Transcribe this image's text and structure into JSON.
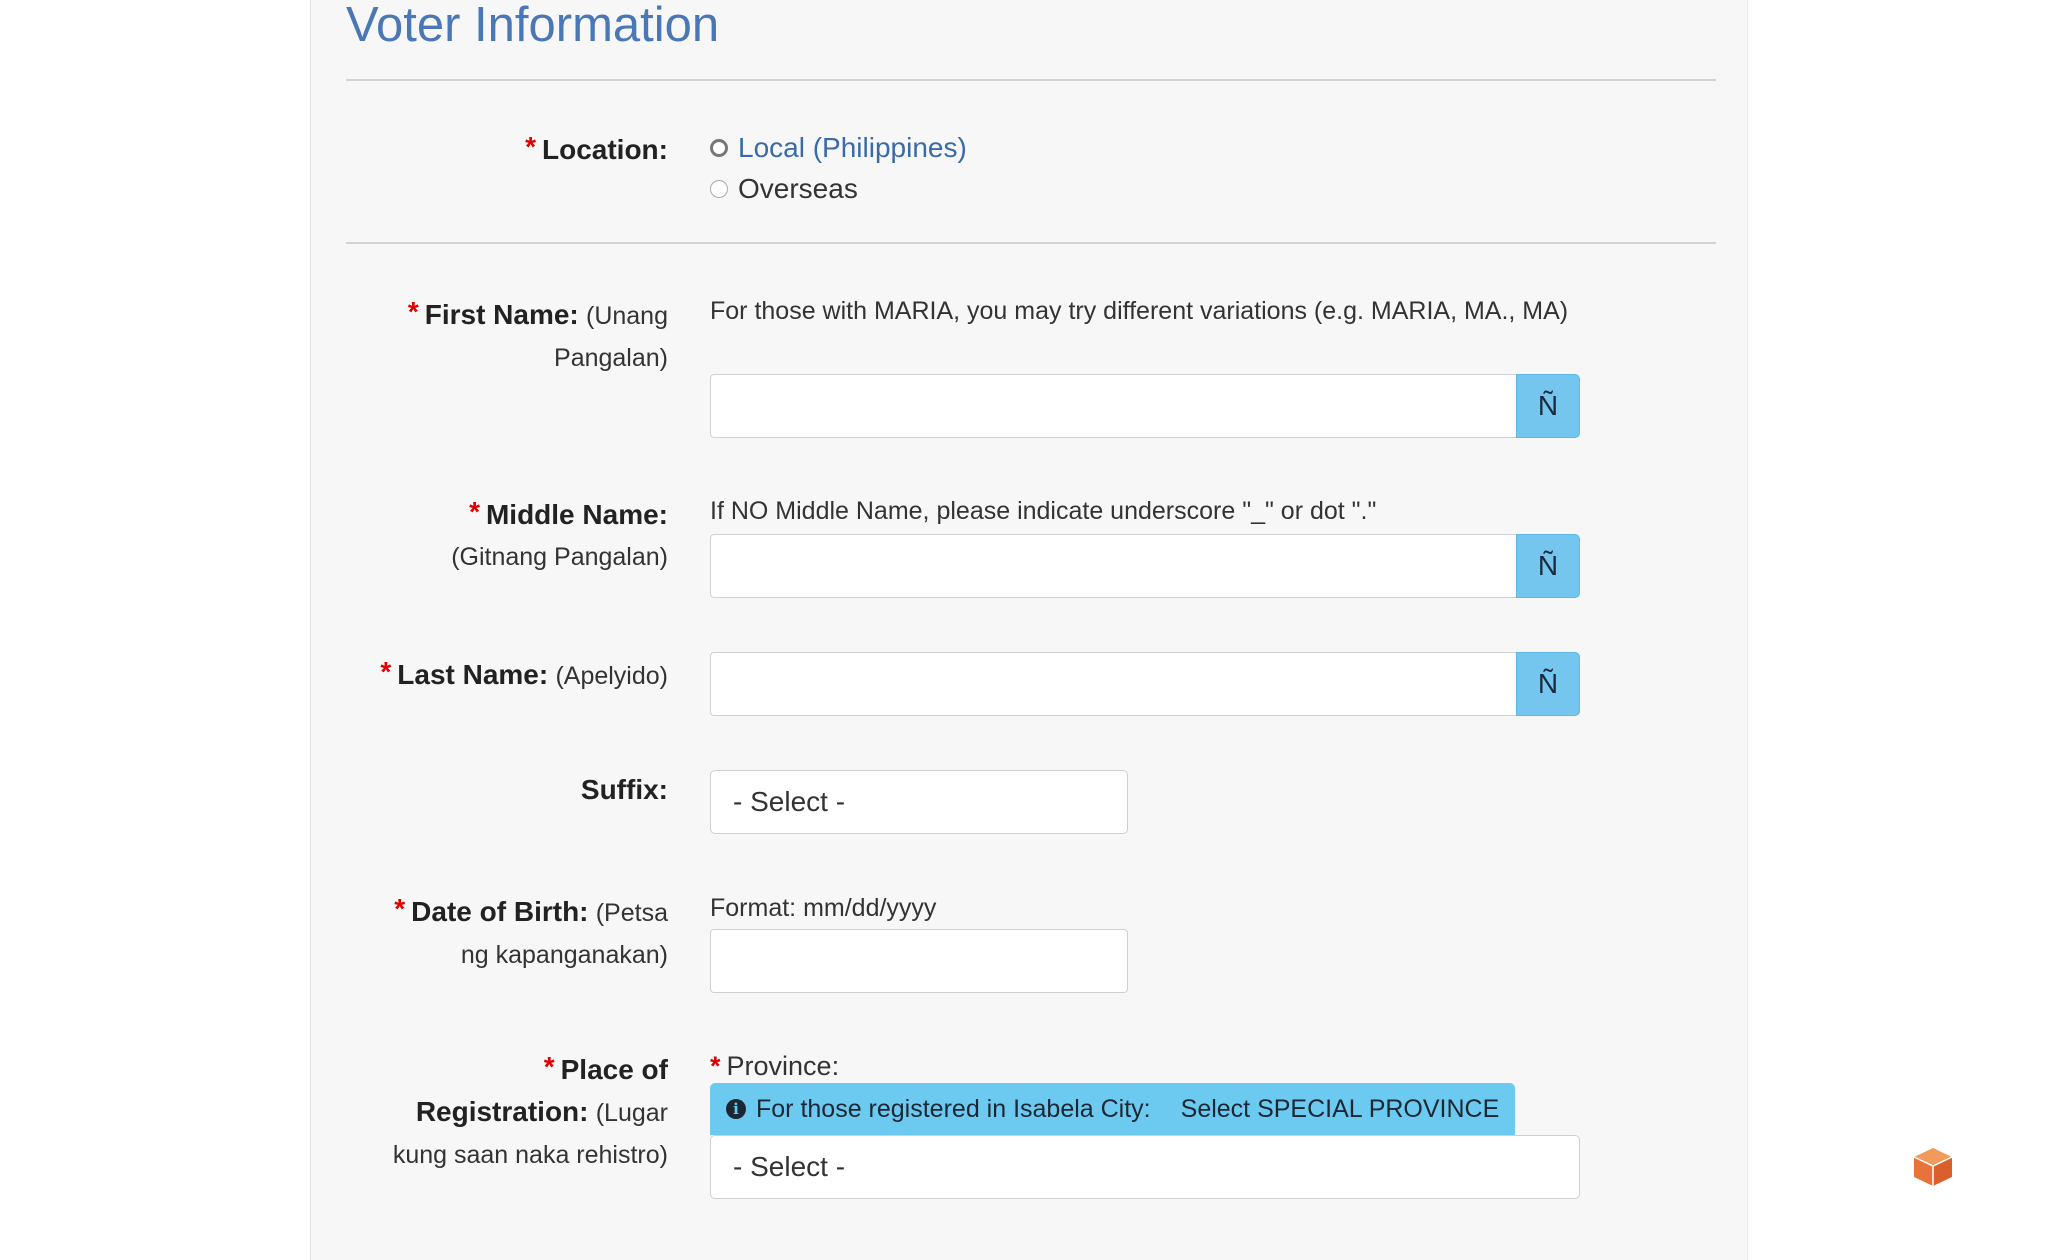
{
  "section": {
    "title": "Voter Information"
  },
  "location": {
    "label": "Location:",
    "options": [
      {
        "label": "Local (Philippines)",
        "selected": true
      },
      {
        "label": "Overseas",
        "selected": false
      }
    ]
  },
  "first_name": {
    "label": "First Name:",
    "sublabel": "(Unang Pangalan)",
    "help": "For those with MARIA, you may try different variations (e.g. MARIA, MA., MA)",
    "value": "",
    "enye_button": "Ñ"
  },
  "middle_name": {
    "label": "Middle Name:",
    "sublabel": "(Gitnang Pangalan)",
    "help": "If NO Middle Name, please indicate underscore \"_\" or dot \".\"",
    "value": "",
    "enye_button": "Ñ"
  },
  "last_name": {
    "label": "Last Name:",
    "sublabel": "(Apelyido)",
    "value": "",
    "enye_button": "Ñ"
  },
  "suffix": {
    "label": "Suffix:",
    "selected": "- Select -"
  },
  "date_of_birth": {
    "label": "Date of Birth:",
    "sublabel": "(Petsa ng kapanganakan)",
    "help": "Format: mm/dd/yyyy",
    "value": ""
  },
  "place_of_registration": {
    "label": "Place of Registration:",
    "sublabel": "(Lugar kung saan naka rehistro)",
    "province_label": "Province:",
    "info_prefix": "For those registered in Isabela City:",
    "info_suffix": "Select SPECIAL PROVINCE",
    "selected": "- Select -"
  },
  "required_marker": "*",
  "icons": {
    "info": "info-circle-icon",
    "widget": "cube-icon"
  },
  "colors": {
    "title_blue": "#4a78b6",
    "required_red": "#e00000",
    "button_blue": "#74c6ee",
    "info_blue": "#6ccaf0",
    "widget_orange": "#e8733a"
  }
}
